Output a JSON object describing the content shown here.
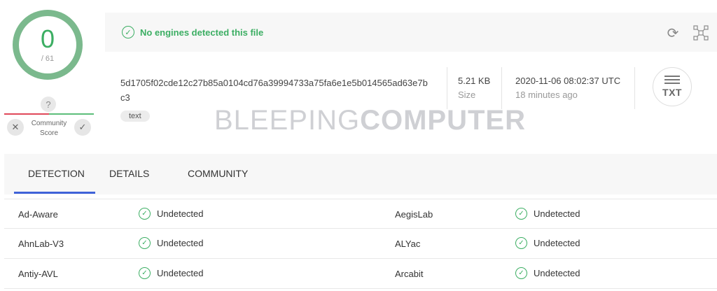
{
  "score": {
    "value": "0",
    "total": "/ 61"
  },
  "community": {
    "question": "?",
    "label_line1": "Community",
    "label_line2": "Score",
    "down_glyph": "✕",
    "up_glyph": "✓"
  },
  "status": {
    "text": "No engines detected this file",
    "icon": "check-circle-icon"
  },
  "file": {
    "hash": "5d1705f02cde12c27b85a0104cd76a39994733a75fa6e1e5b014565ad63e7bc3",
    "tag": "text",
    "size_value": "5.21 KB",
    "size_label": "Size",
    "date": "2020-11-06 08:02:37 UTC",
    "date_relative": "18 minutes ago",
    "type_label": "TXT"
  },
  "watermark": {
    "light": "BLEEPING",
    "bold": "COMPUTER"
  },
  "tabs": [
    {
      "label": "DETECTION",
      "active": true
    },
    {
      "label": "DETAILS",
      "active": false
    },
    {
      "label": "COMMUNITY",
      "active": false
    }
  ],
  "detections": [
    {
      "left_engine": "Ad-Aware",
      "left_result": "Undetected",
      "right_engine": "AegisLab",
      "right_result": "Undetected"
    },
    {
      "left_engine": "AhnLab-V3",
      "left_result": "Undetected",
      "right_engine": "ALYac",
      "right_result": "Undetected"
    },
    {
      "left_engine": "Antiy-AVL",
      "left_result": "Undetected",
      "right_engine": "Arcabit",
      "right_result": "Undetected"
    }
  ],
  "colors": {
    "clean": "#3cae63",
    "ring": "#7bb98d",
    "accent": "#3f63d8",
    "negative": "#e0485a"
  }
}
